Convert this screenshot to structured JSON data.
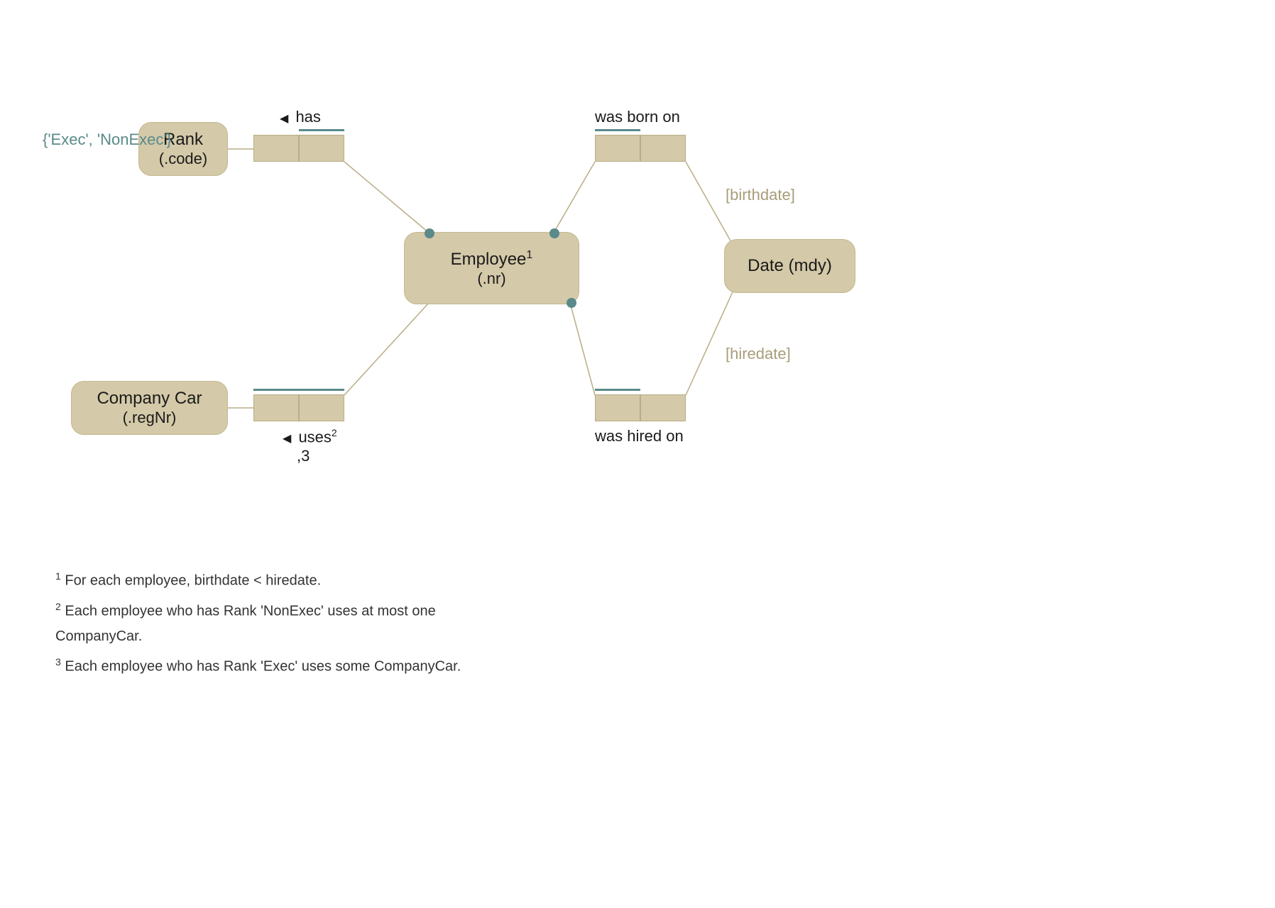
{
  "entities": {
    "rank": {
      "name": "Rank",
      "ref": "(.code)"
    },
    "employee": {
      "name": "Employee",
      "sup": "1",
      "ref": "(.nr)"
    },
    "companycar": {
      "name": "Company Car",
      "ref": "(.regNr)"
    },
    "date": {
      "name": "Date (mdy)"
    }
  },
  "constraint_domain": "{'Exec', 'NonExec'}",
  "predicates": {
    "has": {
      "label": "has",
      "arrow": "◀"
    },
    "born": {
      "label": "was born on"
    },
    "uses": {
      "label": "uses",
      "sup": "2",
      "sub": ",3",
      "arrow": "◀"
    },
    "hired": {
      "label": "was hired on"
    }
  },
  "roles": {
    "birthdate": "[birthdate]",
    "hiredate": "[hiredate]"
  },
  "footnotes": {
    "f1": {
      "num": "1",
      "text": " For each employee, birthdate < hiredate."
    },
    "f2": {
      "num": "2",
      "text": " Each employee who has Rank 'NonExec' uses at most one CompanyCar."
    },
    "f3": {
      "num": "3",
      "text": " Each employee who has Rank 'Exec' uses some CompanyCar."
    }
  },
  "colors": {
    "entity_fill": "#d4c9a8",
    "entity_border": "#b8ad86",
    "teal": "#5a8a8a",
    "muted": "#a89d7a"
  }
}
